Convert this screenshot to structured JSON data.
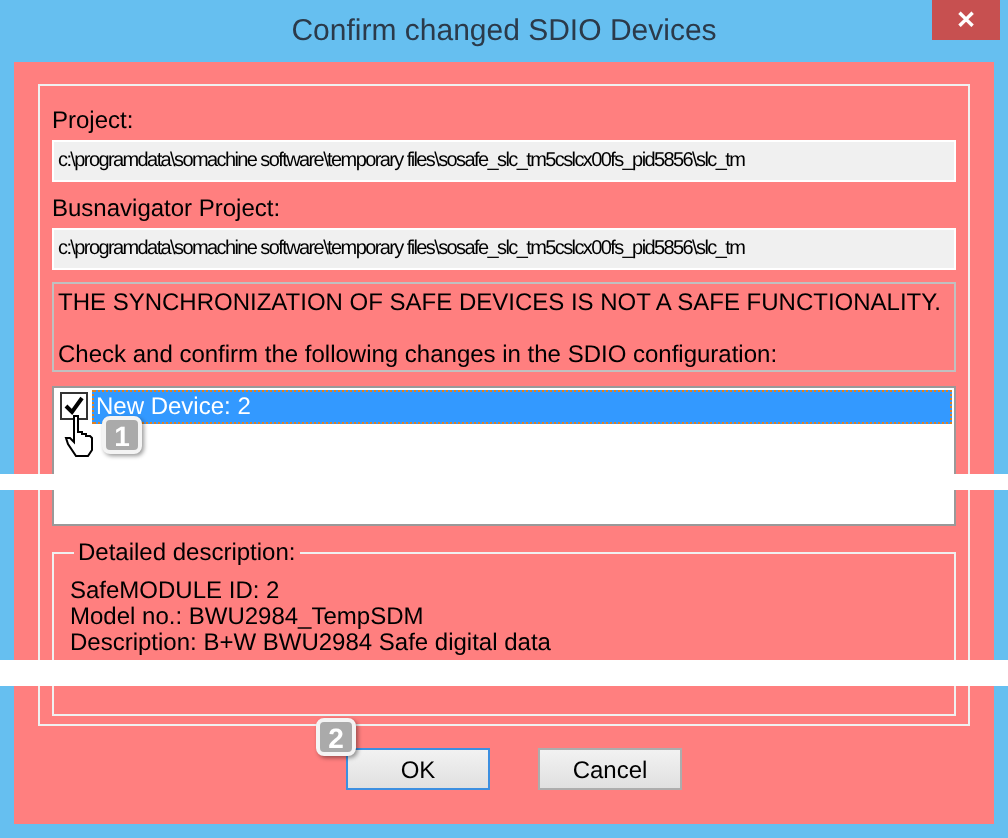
{
  "window": {
    "title": "Confirm changed SDIO Devices",
    "close": "✕"
  },
  "fields": [
    {
      "label": "Project:",
      "value": "c:\\programdata\\somachine software\\temporary files\\sosafe_slc_tm5cslcx00fs_pid5856\\slc_tm"
    },
    {
      "label": "Busnavigator Project:",
      "value": "c:\\programdata\\somachine software\\temporary files\\sosafe_slc_tm5cslcx00fs_pid5856\\slc_tm"
    }
  ],
  "warning": {
    "lines": [
      "THE SYNCHRONIZATION OF SAFE DEVICES IS NOT A SAFE FUNCTIONALITY.",
      "Check and confirm the following changes in the SDIO configuration:"
    ]
  },
  "changes": [
    {
      "label": "New Device: 2",
      "checked": true,
      "selected": true
    }
  ],
  "details": {
    "title": "Detailed description:",
    "lines": [
      "SafeMODULE ID: 2",
      "Model no.: BWU2984_TempSDM",
      "Description: B+W BWU2984 Safe digital data"
    ]
  },
  "buttons": [
    {
      "label": "OK",
      "focused": true
    },
    {
      "label": "Cancel",
      "focused": false
    }
  ],
  "callouts": [
    "1",
    "2"
  ]
}
